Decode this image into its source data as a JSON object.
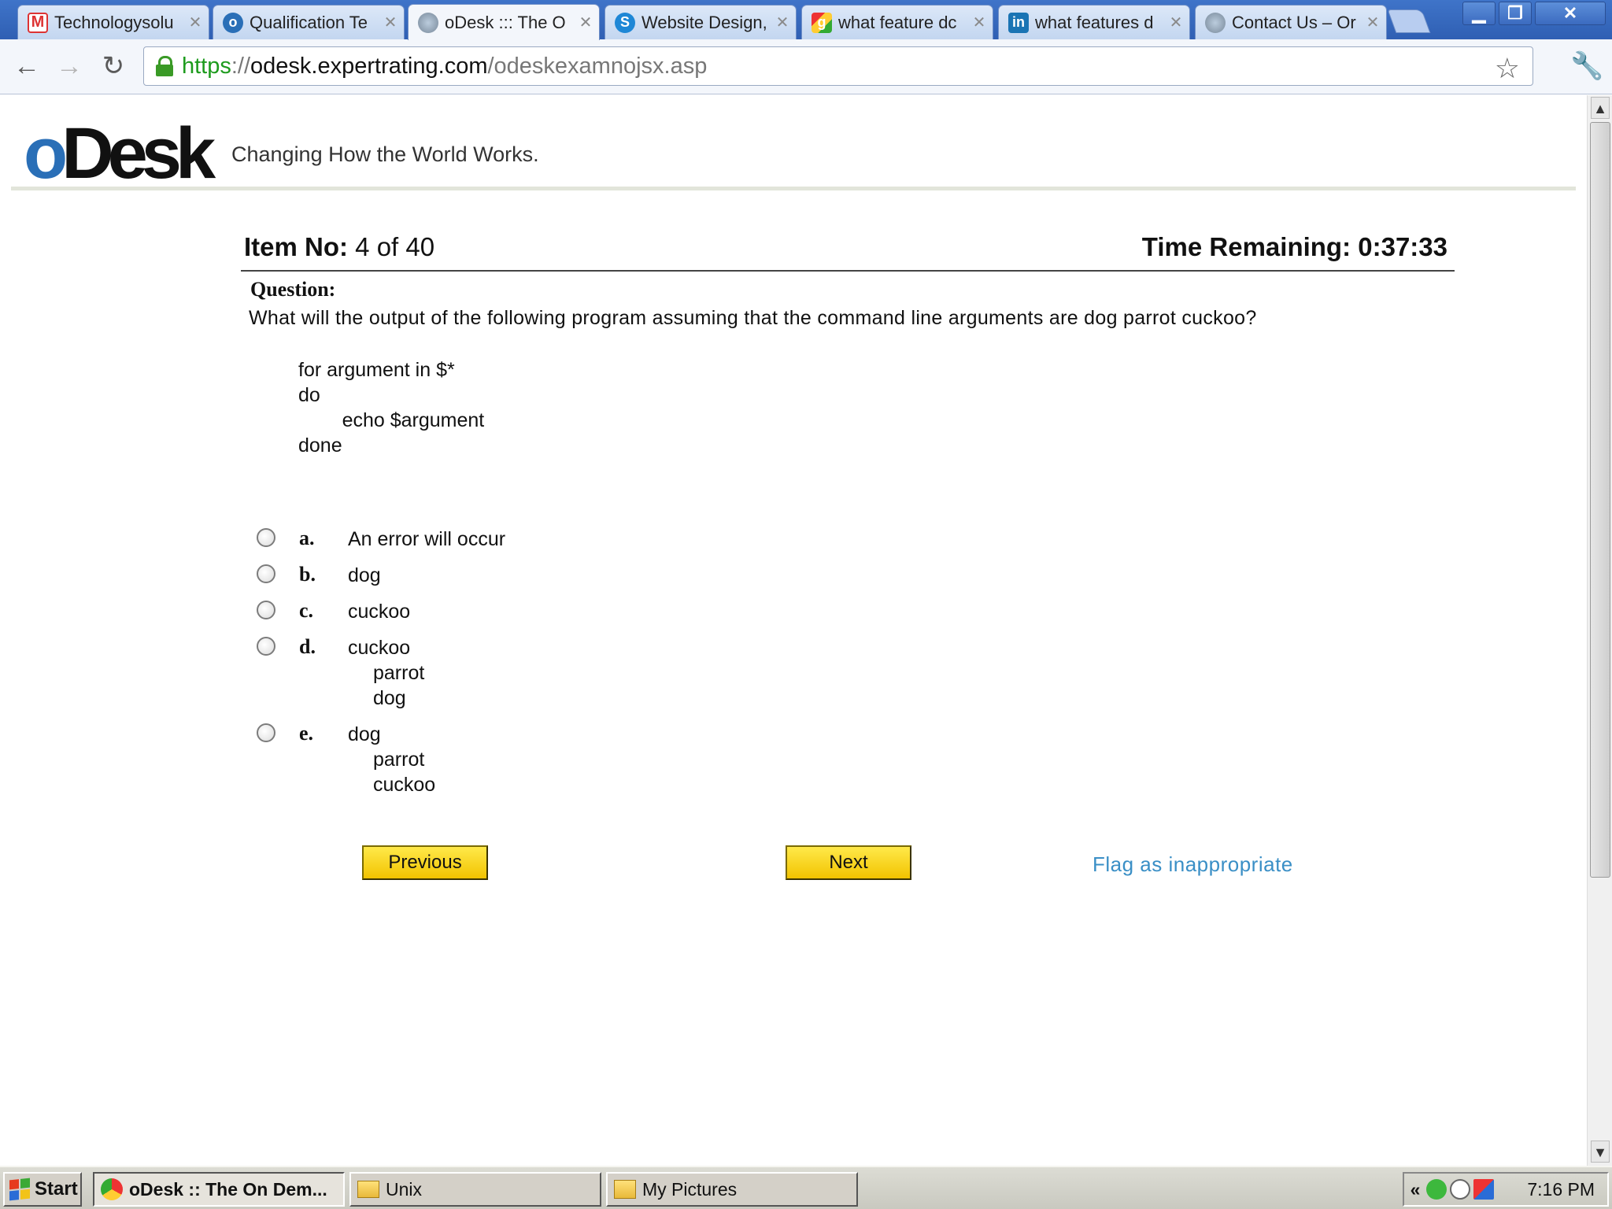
{
  "browser": {
    "tabs": [
      {
        "title": "Technologysolu",
        "icon": "gmail-icon",
        "badge": "0"
      },
      {
        "title": "Qualification Te",
        "icon": "odesk-circle-icon"
      },
      {
        "title": "oDesk ::: The O",
        "icon": "globe-icon",
        "active": true
      },
      {
        "title": "Website Design,",
        "icon": "skype-icon"
      },
      {
        "title": "what feature dc",
        "icon": "google-icon"
      },
      {
        "title": "what features d",
        "icon": "linkedin-icon",
        "glyph": "in"
      },
      {
        "title": "Contact Us – Or",
        "icon": "globe-icon"
      }
    ],
    "close_glyph": "✕",
    "url": {
      "scheme": "https",
      "separator": "://",
      "host": "odesk.expertrating.com",
      "path": "/odeskexamnojsx.asp"
    },
    "window_controls": {
      "minimize": "▁",
      "restore": "❐",
      "close": "✕"
    },
    "nav": {
      "back": "←",
      "forward": "→",
      "reload": "↻",
      "star": "☆",
      "wrench": "🔧"
    }
  },
  "page": {
    "logo": {
      "o": "o",
      "desk": "Desk"
    },
    "tagline": "Changing How the World Works.",
    "item_label": "Item No:",
    "item_value": "4 of 40",
    "time_label": "Time Remaining:",
    "time_value": "0:37:33",
    "question_label": "Question:",
    "question_text": "What will the output of the following program assuming that the command line arguments are dog parrot cuckoo?",
    "code_lines": [
      "for argument in $*",
      "do",
      "        echo $argument",
      "done"
    ],
    "options": [
      {
        "letter": "a.",
        "lines": [
          "An error will occur"
        ]
      },
      {
        "letter": "b.",
        "lines": [
          "dog"
        ]
      },
      {
        "letter": "c.",
        "lines": [
          "cuckoo"
        ]
      },
      {
        "letter": "d.",
        "lines": [
          "cuckoo",
          "parrot",
          "dog"
        ]
      },
      {
        "letter": "e.",
        "lines": [
          "dog",
          "parrot",
          "cuckoo"
        ]
      }
    ],
    "previous_label": "Previous",
    "next_label": "Next",
    "flag_label": "Flag as inappropriate",
    "colors": {
      "accent_link": "#3a8fc6",
      "button_yellow": "#f2c300",
      "logo_blue": "#2a6fb7"
    }
  },
  "taskbar": {
    "start_label": "Start",
    "tasks": [
      {
        "label": "oDesk :: The On Dem...",
        "icon": "chrome-icon",
        "active": true
      },
      {
        "label": "Unix",
        "icon": "folder-icon"
      },
      {
        "label": "My Pictures",
        "icon": "pictures-folder-icon"
      }
    ],
    "tray_chevron": "«",
    "clock": "7:16 PM"
  }
}
